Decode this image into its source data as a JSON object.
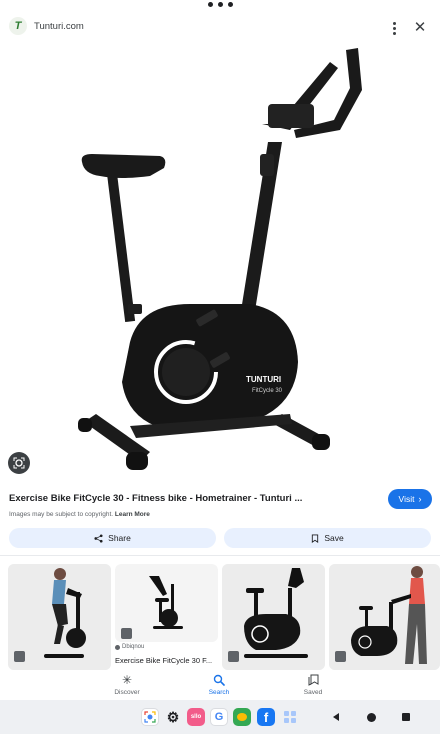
{
  "header": {
    "site_name": "Tunturi.com",
    "logo_letter": "T"
  },
  "hero": {
    "brand_text": "TUNTURI",
    "model_text": "FitCycle 30"
  },
  "result": {
    "title": "Exercise Bike FitCycle 30 - Fitness bike - Hometrainer - Tunturi ...",
    "visit_label": "Visit",
    "copyright_text": "Images may be subject to copyright.",
    "learn_more_label": "Learn More"
  },
  "actions": {
    "share_label": "Share",
    "save_label": "Save"
  },
  "related": [
    {
      "source": "",
      "caption": ""
    },
    {
      "source": "Dbiqnou",
      "caption": "Exercise Bike FitCycle 30 F..."
    },
    {
      "source": "",
      "caption": ""
    },
    {
      "source": "",
      "caption": ""
    }
  ],
  "bottom_nav": [
    {
      "label": "Discover",
      "icon": "asterisk-icon",
      "active": false
    },
    {
      "label": "Search",
      "icon": "search-icon",
      "active": true
    },
    {
      "label": "Saved",
      "icon": "bookmark-icon",
      "active": false
    }
  ],
  "taskbar": {
    "apps": [
      "lens-app",
      "settings-app",
      "sololearn-app",
      "google-app",
      "photos-app",
      "facebook-app",
      "apps-grid"
    ],
    "google_letter": "G",
    "facebook_letter": "f",
    "sololearn_text": "sllo"
  },
  "colors": {
    "accent": "#1a73e8",
    "chip_bg": "#e8f0fe",
    "facebook": "#1877f2",
    "logo_green": "#2e7d32"
  }
}
